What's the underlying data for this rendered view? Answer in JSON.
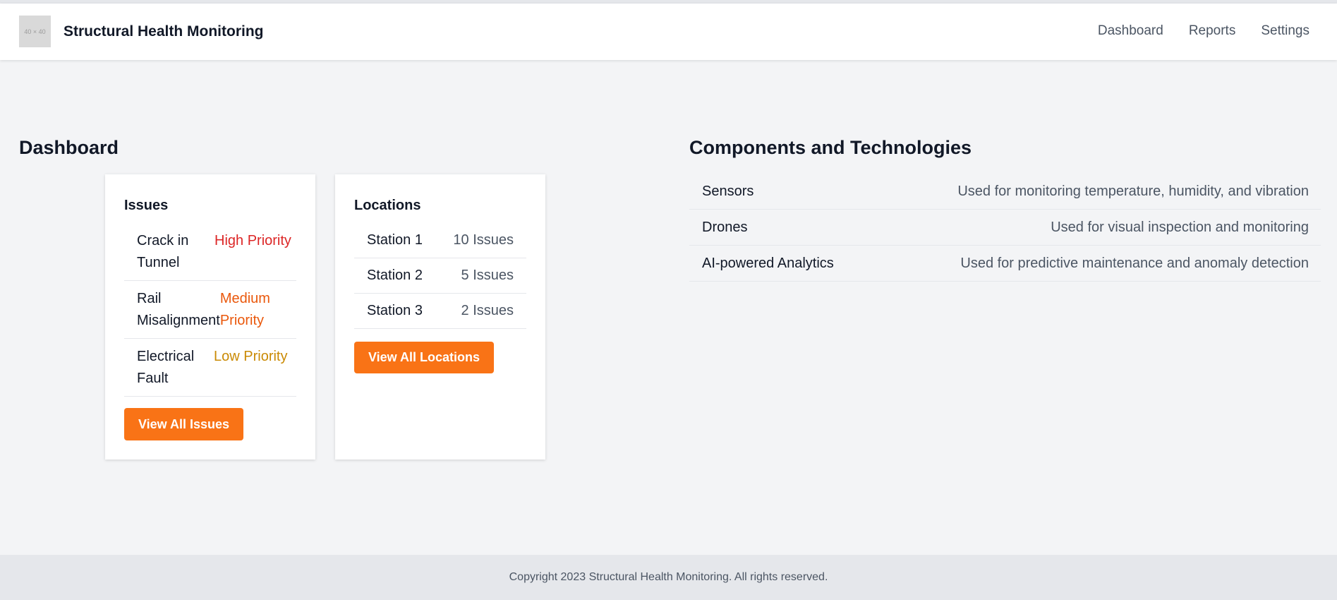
{
  "header": {
    "logo_text": "40 × 40",
    "brand": "Structural Health Monitoring",
    "nav": [
      "Dashboard",
      "Reports",
      "Settings"
    ]
  },
  "dashboard": {
    "title": "Dashboard",
    "issues": {
      "title": "Issues",
      "items": [
        {
          "name": "Crack in Tunnel",
          "priority": "High Priority",
          "color": "#dc2626"
        },
        {
          "name": "Rail Misalignment",
          "priority": "Medium Priority",
          "color": "#ea580c"
        },
        {
          "name": "Electrical Fault",
          "priority": "Low Priority",
          "color": "#ca8a04"
        }
      ],
      "button": "View All Issues"
    },
    "locations": {
      "title": "Locations",
      "items": [
        {
          "name": "Station 1",
          "count": "10 Issues"
        },
        {
          "name": "Station 2",
          "count": "5 Issues"
        },
        {
          "name": "Station 3",
          "count": "2 Issues"
        }
      ],
      "button": "View All Locations"
    }
  },
  "components": {
    "title": "Components and Technologies",
    "rows": [
      {
        "name": "Sensors",
        "desc": "Used for monitoring temperature, humidity, and vibration"
      },
      {
        "name": "Drones",
        "desc": "Used for visual inspection and monitoring"
      },
      {
        "name": "AI-powered Analytics",
        "desc": "Used for predictive maintenance and anomaly detection"
      }
    ]
  },
  "footer": {
    "text": "Copyright 2023 Structural Health Monitoring. All rights reserved."
  },
  "colors": {
    "accent": "#f97316",
    "background": "#f3f4f6"
  }
}
